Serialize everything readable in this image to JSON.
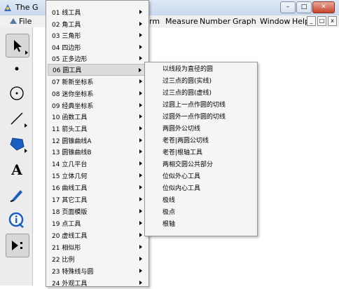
{
  "window": {
    "title": "The G",
    "buttons": [
      "–",
      "□",
      "✕"
    ]
  },
  "menubar": {
    "file": "File",
    "items": [
      {
        "label": "rm"
      },
      {
        "label": "Measure"
      },
      {
        "label": "Number"
      },
      {
        "label": "Graph"
      },
      {
        "label": "Window"
      },
      {
        "label": "Help"
      }
    ],
    "mdi_buttons": [
      "_",
      "□",
      "x"
    ]
  },
  "toolbar": {
    "tools": [
      {
        "icon": "arrow-select-icon"
      },
      {
        "icon": "point-icon"
      },
      {
        "icon": "compass-icon"
      },
      {
        "icon": "straightedge-icon"
      },
      {
        "icon": "polygon-icon"
      },
      {
        "icon": "text-icon",
        "glyph": "A"
      },
      {
        "icon": "marker-icon"
      },
      {
        "icon": "information-icon"
      },
      {
        "icon": "custom-tool-icon"
      }
    ]
  },
  "menu": {
    "items": [
      {
        "label": "01 线工具"
      },
      {
        "label": "02 角工具"
      },
      {
        "label": "03 三角形"
      },
      {
        "label": "04 四边形"
      },
      {
        "label": "05 正多边形"
      },
      {
        "label": "06 圆工具"
      },
      {
        "label": "07 新新坐标系"
      },
      {
        "label": "08 迷你坐标系"
      },
      {
        "label": "09 经典坐标系"
      },
      {
        "label": "10 函数工具"
      },
      {
        "label": "11 箭头工具"
      },
      {
        "label": "12 圆锥曲线A"
      },
      {
        "label": "13 圆锥曲线B"
      },
      {
        "label": "14 立几平台"
      },
      {
        "label": "15 立体几何"
      },
      {
        "label": "16 曲线工具"
      },
      {
        "label": "17 其它工具"
      },
      {
        "label": "18 页面模版"
      },
      {
        "label": "19 点工具"
      },
      {
        "label": "20 虚线工具"
      },
      {
        "label": "21 相似形"
      },
      {
        "label": "22 比例"
      },
      {
        "label": "23 特殊线与圆"
      },
      {
        "label": "24 外观工具"
      }
    ]
  },
  "submenu": {
    "items": [
      {
        "label": "以线段为直径的圆"
      },
      {
        "label": "过三点的圆(实线)"
      },
      {
        "label": "过三点的圆(虚线)"
      },
      {
        "label": "过圆上一点作圆的切线"
      },
      {
        "label": "过圆外一点作圆的切线"
      },
      {
        "label": "两圆外公切线"
      },
      {
        "label": "老苍|两圆公切线"
      },
      {
        "label": "老苍|根轴工具"
      },
      {
        "label": "两相交圆公共部分"
      },
      {
        "label": "位似外心工具"
      },
      {
        "label": "位似内心工具"
      },
      {
        "label": "极线"
      },
      {
        "label": "极点"
      },
      {
        "label": "根轴"
      }
    ]
  }
}
